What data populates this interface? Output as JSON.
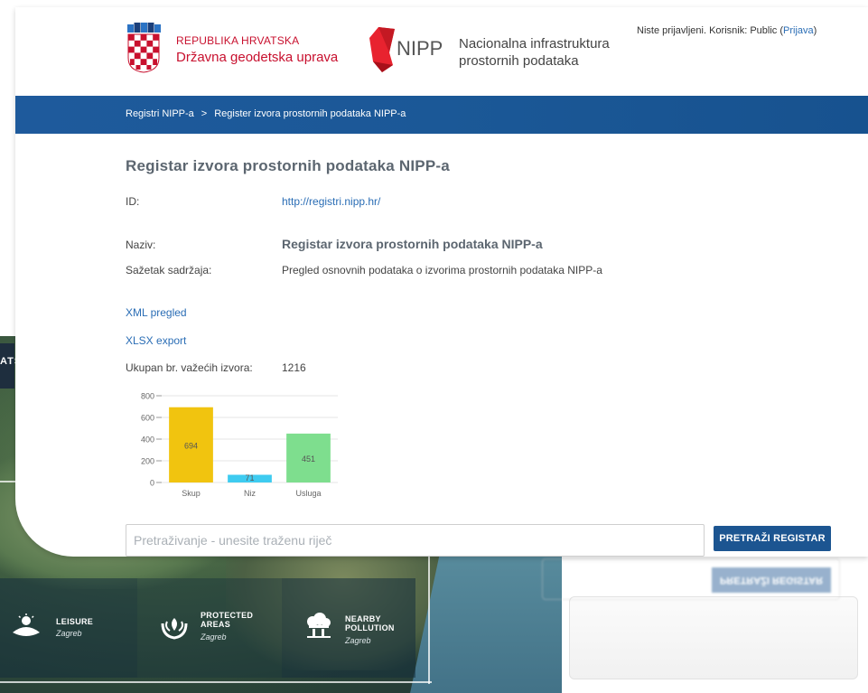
{
  "header": {
    "org_top": "REPUBLIKA HRVATSKA",
    "org_bottom": "Državna geodetska uprava",
    "nipp_logo_text": "NIPP",
    "nipp_line1": "Nacionalna infrastruktura",
    "nipp_line2": "prostornih podataka",
    "login_text": "Niste prijavljeni. Korisnik: Public (",
    "login_link": "Prijava",
    "login_close": ")"
  },
  "breadcrumb": {
    "item1": "Registri NIPP-a",
    "sep": ">",
    "item2": "Register izvora prostornih podataka NIPP-a"
  },
  "main": {
    "title": "Registar izvora prostornih podataka NIPP-a",
    "id_label": "ID:",
    "id_value": "http://registri.nipp.hr/",
    "name_label": "Naziv:",
    "name_value": "Registar izvora prostornih podataka NIPP-a",
    "summary_label": "Sažetak sadržaja:",
    "summary_value": "Pregled osnovnih podataka o izvorima prostornih podataka NIPP-a",
    "xml_link": "XML pregled",
    "xlsx_link": "XLSX export",
    "total_label": "Ukupan br. važećih izvora:",
    "total_value": "1216"
  },
  "search": {
    "placeholder": "Pretraživanje - unesite traženu riječ",
    "button": "PRETRAŽI REGISTAR"
  },
  "background": {
    "band_text": "ATS",
    "tiles": [
      {
        "title": "LEISURE",
        "sub": "Zagreb"
      },
      {
        "title": "PROTECTED AREAS",
        "sub": "Zagreb"
      },
      {
        "title": "NEARBY POLLUTION",
        "sub": "Zagreb"
      }
    ],
    "mirror_button": "PRETRAŽI REGISTAR"
  },
  "colors": {
    "brand_red": "#c8102e",
    "brand_blue": "#1c5591",
    "link": "#2a6db5"
  },
  "chart_data": {
    "type": "bar",
    "categories": [
      "Skup",
      "Niz",
      "Usluga"
    ],
    "values": [
      694,
      71,
      451
    ],
    "colors": [
      "#f1c40f",
      "#3ecbf0",
      "#7ede8e"
    ],
    "ylim": [
      0,
      800
    ],
    "yticks": [
      0,
      200,
      400,
      600,
      800
    ],
    "grid": true,
    "data_labels": true
  }
}
